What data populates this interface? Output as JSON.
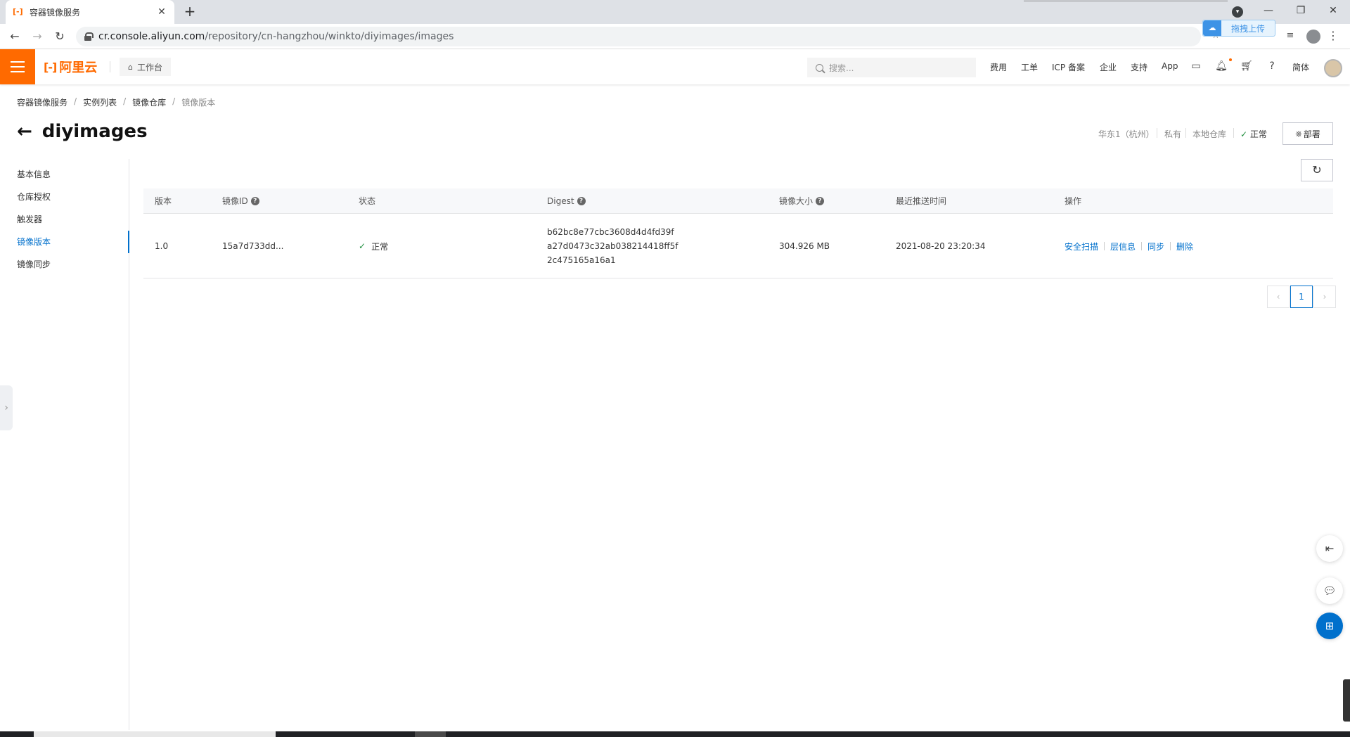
{
  "browser": {
    "tab_title": "容器镜像服务",
    "tab_favicon": "aliyun-favicon",
    "url_host": "cr.console.aliyun.com",
    "url_path": "/repository/cn-hangzhou/winkto/diyimages/images",
    "upload_button": "拖拽上传"
  },
  "topbar": {
    "logo_text": "阿里云",
    "workbench": "工作台",
    "search_placeholder": "搜索...",
    "nav": [
      "费用",
      "工单",
      "ICP 备案",
      "企业",
      "支持",
      "App"
    ],
    "lang": "简体",
    "accent_color": "#ff6a00"
  },
  "breadcrumb": [
    "容器镜像服务",
    "实例列表",
    "镜像仓库",
    "镜像版本"
  ],
  "page": {
    "title": "diyimages",
    "region": "华东1（杭州）",
    "visibility": "私有",
    "repo_type": "本地仓库",
    "status": "正常",
    "deploy_button": "部署"
  },
  "sidenav": {
    "items": [
      "基本信息",
      "仓库授权",
      "触发器",
      "镜像版本",
      "镜像同步"
    ],
    "active": "镜像版本"
  },
  "table": {
    "headers": {
      "version": "版本",
      "image_id": "镜像ID",
      "status": "状态",
      "digest": "Digest",
      "size": "镜像大小",
      "pushed": "最近推送时间",
      "ops": "操作"
    },
    "rows": [
      {
        "version": "1.0",
        "image_id": "15a7d733dd...",
        "status": "正常",
        "digest_lines": [
          "b62bc8e77cbc3608d4d4fd39f",
          "a27d0473c32ab038214418ff5f",
          "2c475165a16a1"
        ],
        "size": "304.926 MB",
        "pushed": "2021-08-20 23:20:34",
        "ops": [
          "安全扫描",
          "层信息",
          "同步",
          "删除"
        ]
      }
    ]
  },
  "pagination": {
    "current_page": "1"
  },
  "colors": {
    "link": "#0070cc",
    "success": "#1e8e3e"
  }
}
